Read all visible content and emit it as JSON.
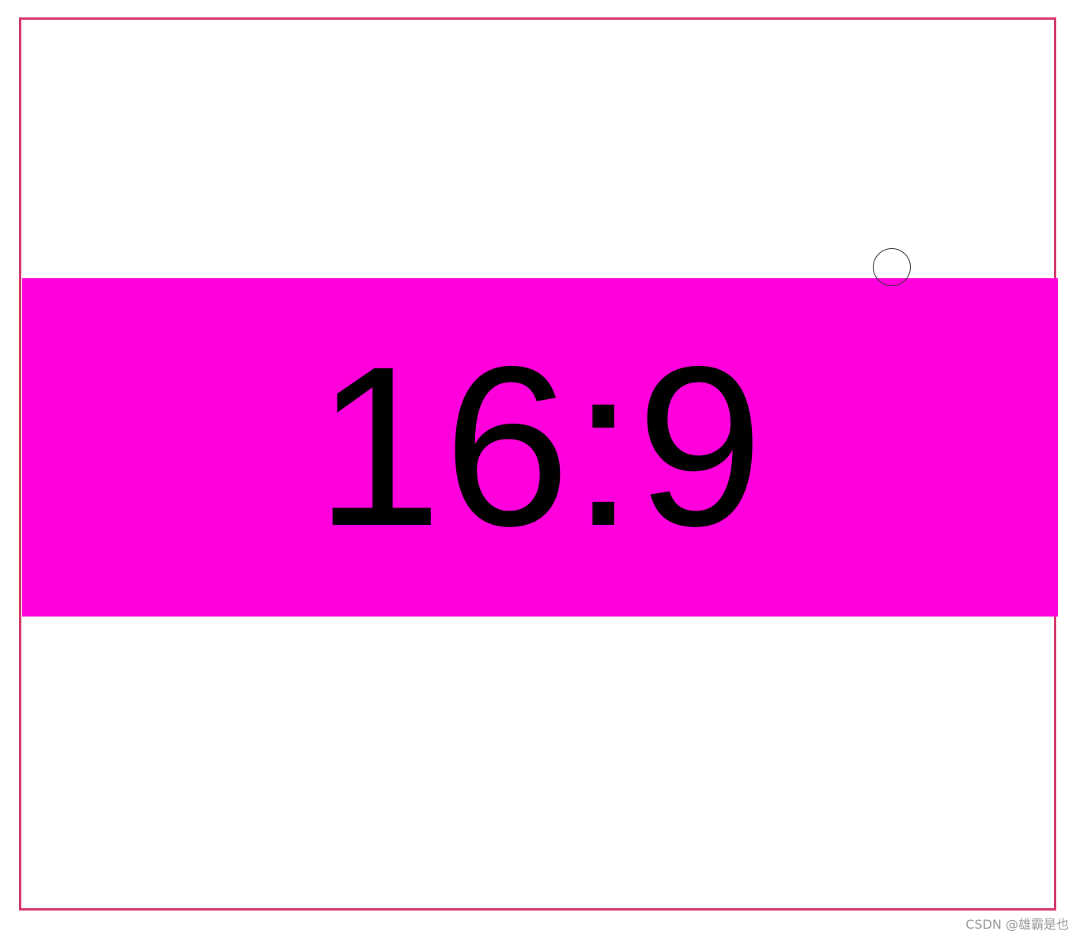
{
  "screen": {
    "aspect_ratio_label": "16:9",
    "watermark_text": "CSDN @雄霸是也"
  },
  "colors": {
    "frame_border": "#d63c6c",
    "band_fill": "#ff00dd",
    "label_text": "#000000",
    "background": "#ffffff"
  },
  "icons": {
    "cursor": "cursor-circle-icon"
  }
}
